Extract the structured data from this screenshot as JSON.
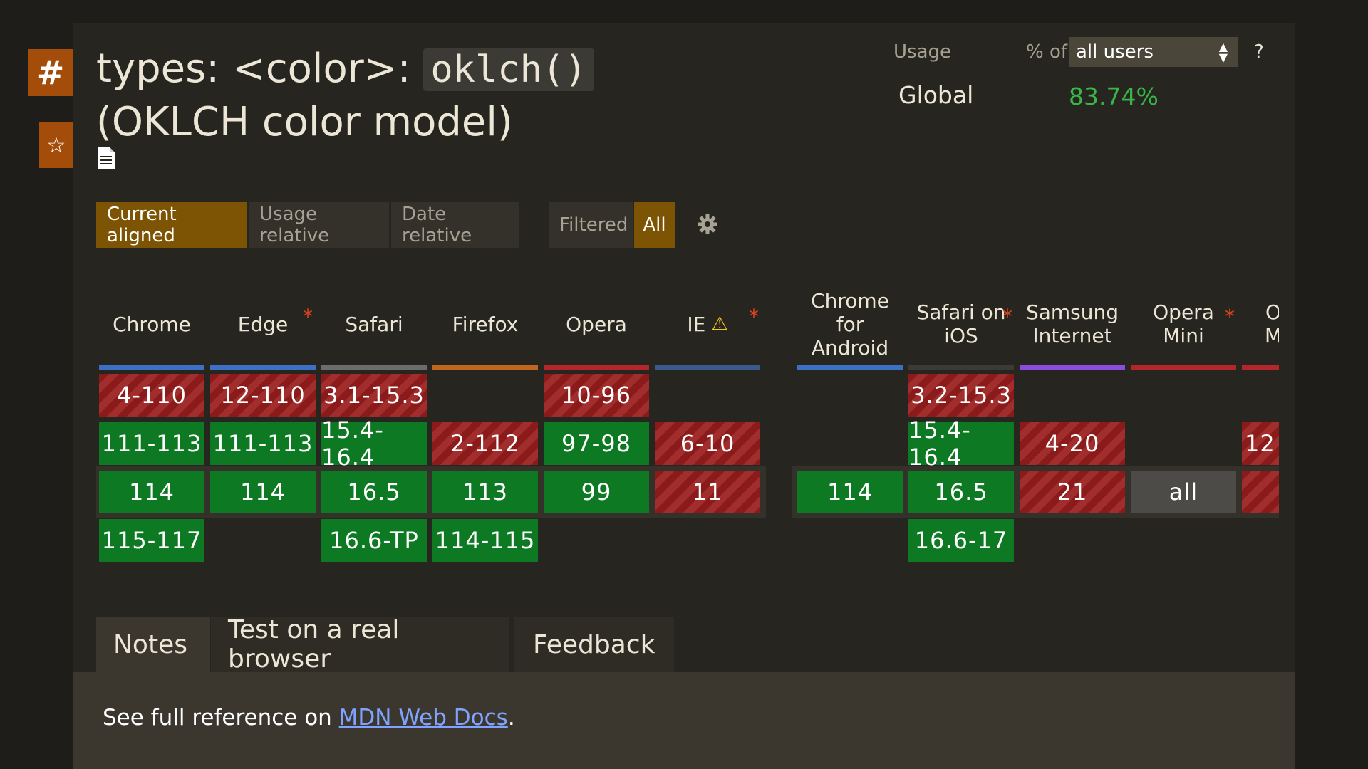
{
  "sidebar": {
    "hash_label": "#",
    "star_icon": "star-icon"
  },
  "title": {
    "prefix": "types: <color>: ",
    "code": "oklch()",
    "suffix": " (OKLCH color model)"
  },
  "usage": {
    "label": "Usage",
    "pct_of": "% of",
    "select_value": "all users",
    "help": "?",
    "global_label": "Global",
    "global_value": "83.74%"
  },
  "view_toggles": [
    "Current aligned",
    "Usage relative",
    "Date relative"
  ],
  "filter_toggles": [
    "Filtered",
    "All"
  ],
  "browsers": [
    {
      "name": "Chrome",
      "accent": "#3d6fc4",
      "asterisk": false
    },
    {
      "name": "Edge",
      "accent": "#3d6fc4",
      "asterisk": true
    },
    {
      "name": "Safari",
      "accent": "#6c6c6c",
      "asterisk": false
    },
    {
      "name": "Firefox",
      "accent": "#c0661f",
      "asterisk": false
    },
    {
      "name": "Opera",
      "accent": "#b5262b",
      "asterisk": false
    },
    {
      "name": "IE",
      "accent": "#3b5a8c",
      "asterisk": true,
      "warning": "⚠"
    },
    {
      "name": "Chrome for Android",
      "accent": "#3d6fc4",
      "asterisk": false
    },
    {
      "name": "Safari on iOS",
      "accent": "#3b3a36",
      "asterisk": true
    },
    {
      "name": "Samsung Internet",
      "accent": "#8b4cdb",
      "asterisk": false
    },
    {
      "name": "Opera Mini",
      "accent": "#b5262b",
      "asterisk": true
    },
    {
      "name": "O M",
      "accent": "#b5262b",
      "asterisk": false
    }
  ],
  "cells": {
    "chrome": [
      "4-110",
      "111-113",
      "114",
      "115-117"
    ],
    "edge": [
      "12-110",
      "111-113",
      "114"
    ],
    "safari": [
      "3.1-15.3",
      "15.4-16.4",
      "16.5",
      "16.6-TP"
    ],
    "firefox": [
      "2-112",
      "113",
      "114-115"
    ],
    "opera": [
      "10-96",
      "97-98",
      "99"
    ],
    "ie": [
      "6-10",
      "11"
    ],
    "chrome_android": [
      "114"
    ],
    "safari_ios": [
      "3.2-15.3",
      "15.4-16.4",
      "16.5",
      "16.6-17"
    ],
    "samsung": [
      "4-20",
      "21"
    ],
    "opera_mini": [
      "all"
    ],
    "opera_mobile": [
      "12"
    ]
  },
  "tabs": [
    "Notes",
    "Test on a real browser",
    "Feedback"
  ],
  "notes": {
    "text": "See full reference on ",
    "link": "MDN Web Docs",
    "end": "."
  }
}
